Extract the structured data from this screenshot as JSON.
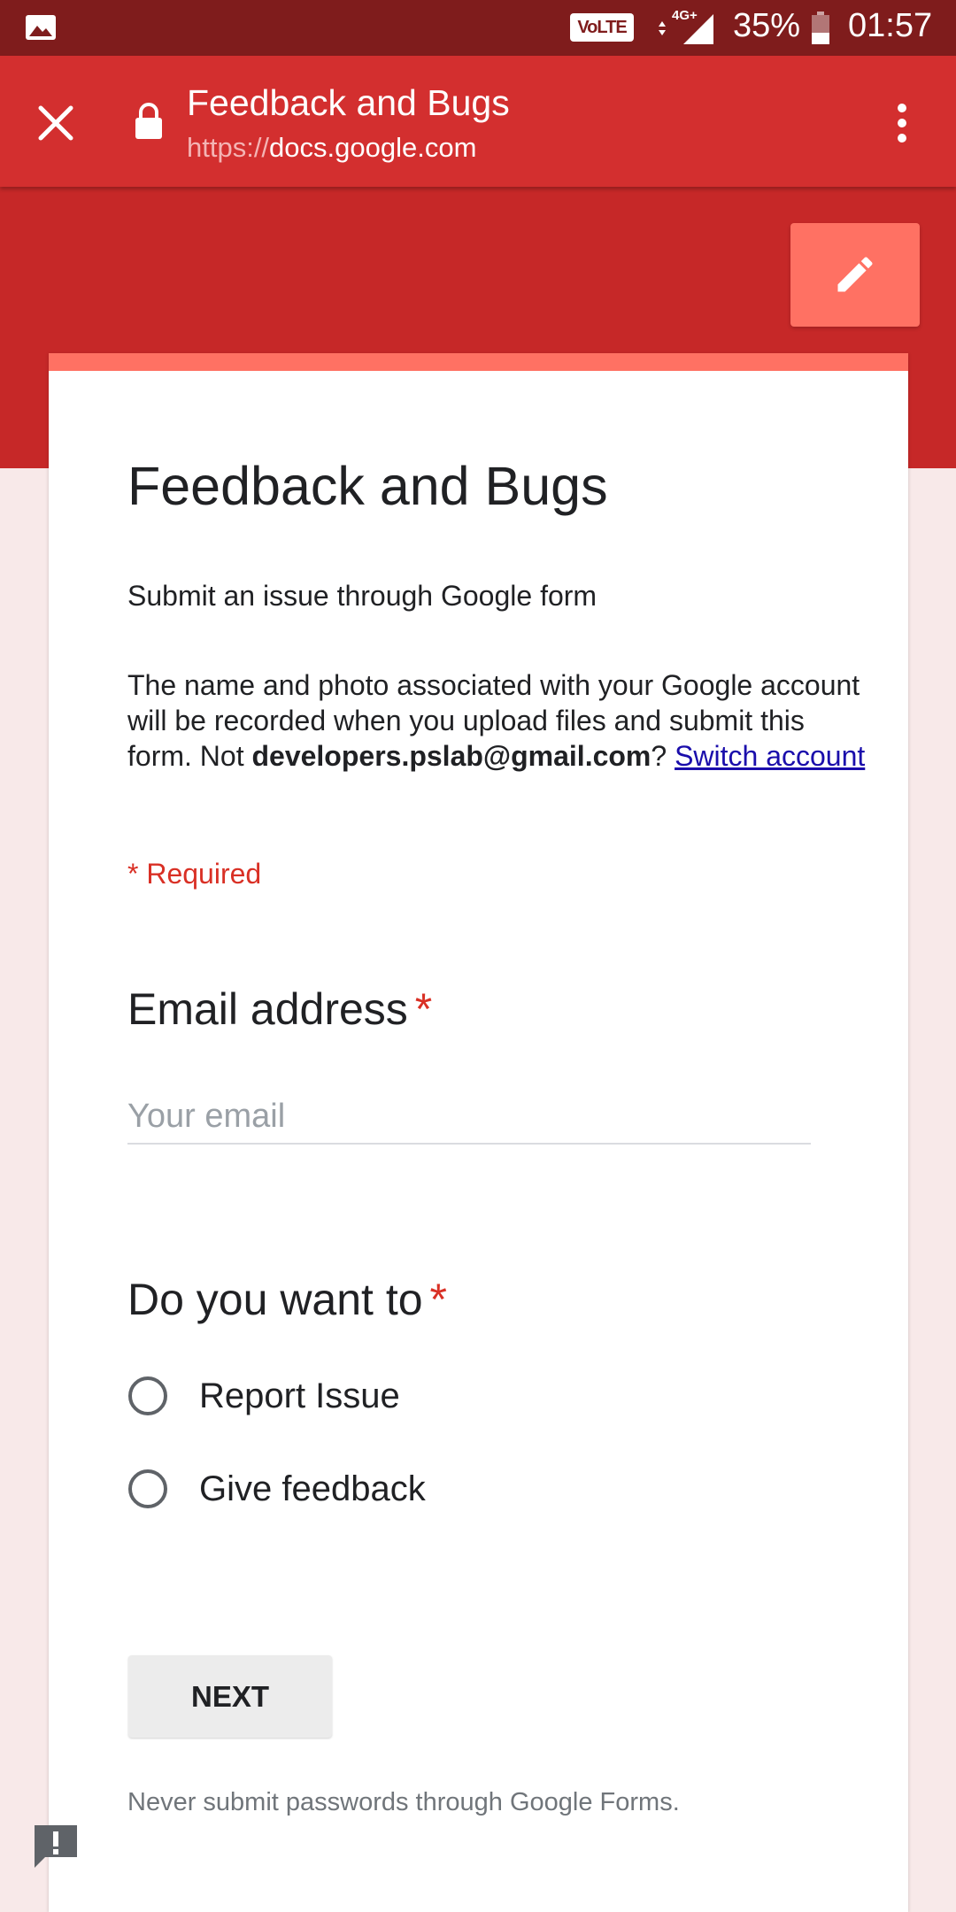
{
  "status_bar": {
    "volte_label": "VoLTE",
    "network_label": "4G+",
    "battery_percent": "35%",
    "time": "01:57",
    "icons": [
      "gallery-icon",
      "volte-icon",
      "data-arrows-icon",
      "signal-icon",
      "battery-icon"
    ]
  },
  "app_bar": {
    "title": "Feedback and Bugs",
    "url_protocol": "https://",
    "url_domain": "docs.google.com",
    "icons": [
      "close-icon",
      "lock-icon",
      "more-vert-icon"
    ]
  },
  "edit_fab": {
    "icon": "edit-icon"
  },
  "form": {
    "title": "Feedback and Bugs",
    "subtitle": "Submit an issue through Google form",
    "notice_text": "The name and photo associated with your Google account will be recorded when you upload files and submit this form. Not ",
    "account": "developers.pslab@gmail.com",
    "question_mark": "?",
    "switch_account": "Switch account",
    "required_note": "* Required",
    "email": {
      "label": "Email address",
      "required_mark": "*",
      "placeholder": "Your email",
      "value": ""
    },
    "choice": {
      "label": "Do you want to",
      "required_mark": "*",
      "options": [
        {
          "label": "Report Issue",
          "selected": false
        },
        {
          "label": "Give feedback",
          "selected": false
        }
      ]
    },
    "next_button": "NEXT",
    "disclaimer": "Never submit passwords through Google Forms."
  },
  "colors": {
    "status_bar": "#7f1c1c",
    "app_bar": "#d32f2f",
    "header_band": "#c62828",
    "accent": "#ff7163",
    "background": "#f8e9e9",
    "required": "#d93025",
    "link": "#1a0dab"
  },
  "report_icon": "report-problem-icon"
}
